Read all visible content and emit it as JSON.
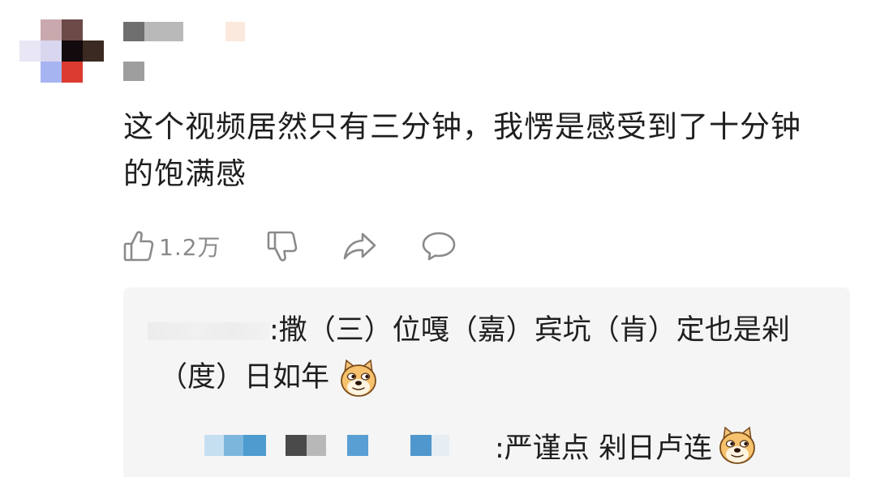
{
  "comment": {
    "text_line1": "这个视频居然只有三分钟，我愣是感受到了十分钟",
    "text_line2": "的饱满感",
    "like_count": "1.2万"
  },
  "icons": {
    "like": "thumbs-up-icon",
    "dislike": "thumbs-down-icon",
    "share": "share-arrow-icon",
    "reply": "speech-bubble-icon",
    "emoji": "doge-emoji-icon"
  },
  "replies": [
    {
      "text_line1": ":撒（三）位嘎（嘉）宾坑（肯）定也是剁",
      "text_line2": "（度）日如年"
    },
    {
      "text": ":严谨点 剁日卢连"
    }
  ],
  "colors": {
    "text": "#1f1f1f",
    "muted": "#8a8a8a",
    "reply_bg": "#f5f5f5"
  }
}
